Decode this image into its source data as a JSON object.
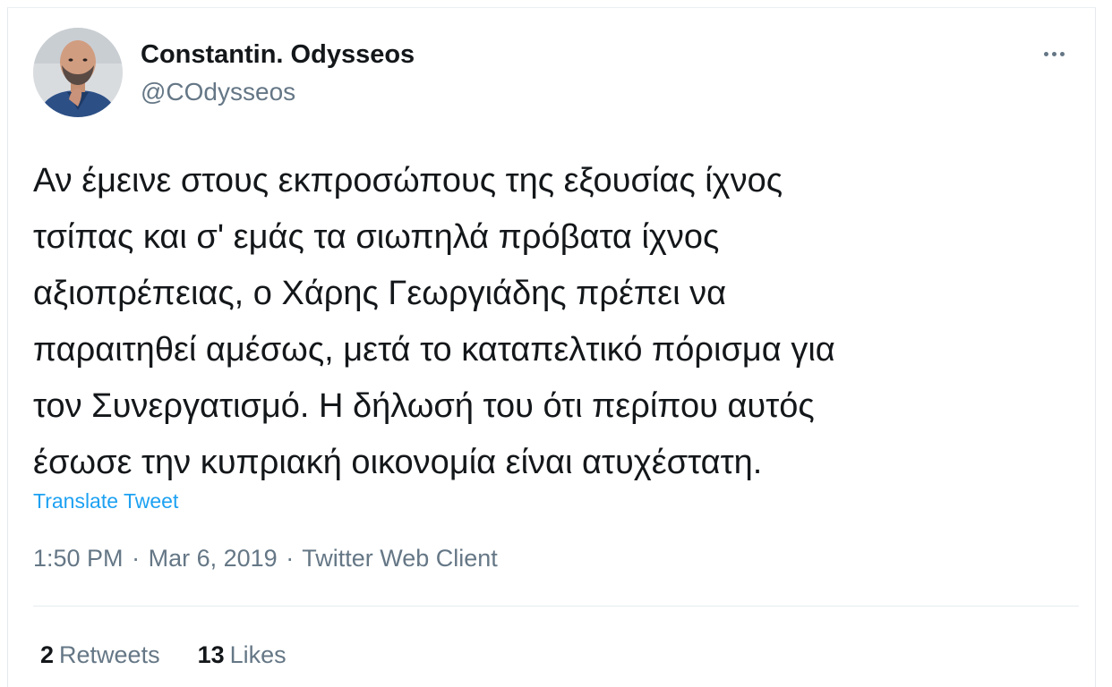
{
  "tweet": {
    "author": {
      "display_name": "Constantin. Odysseos",
      "handle": "@COdysseos"
    },
    "text_lines": [
      "Αν έμεινε στους εκπροσώπους της εξουσίας ίχνος",
      "τσίπας και σ' εμάς τα σιωπηλά πρόβατα ίχνος",
      "αξιοπρέπειας, ο Χάρης Γεωργιάδης πρέπει να",
      "παραιτηθεί αμέσως, μετά το καταπελτικό πόρισμα για",
      "τον Συνεργατισμό. Η δήλωσή του ότι περίπου αυτός",
      "έσωσε την κυπριακή οικονομία είναι ατυχέστατη."
    ],
    "translate_label": "Translate Tweet",
    "time": "1:50 PM",
    "date": "Mar 6, 2019",
    "separator": "·",
    "source": "Twitter Web Client",
    "retweets_count": "2",
    "retweets_label": "Retweets",
    "likes_count": "13",
    "likes_label": "Likes",
    "more_icon": "more-horizontal-icon"
  },
  "colors": {
    "link": "#1da1f2",
    "secondary_text": "#657786",
    "primary_text": "#14171a"
  }
}
